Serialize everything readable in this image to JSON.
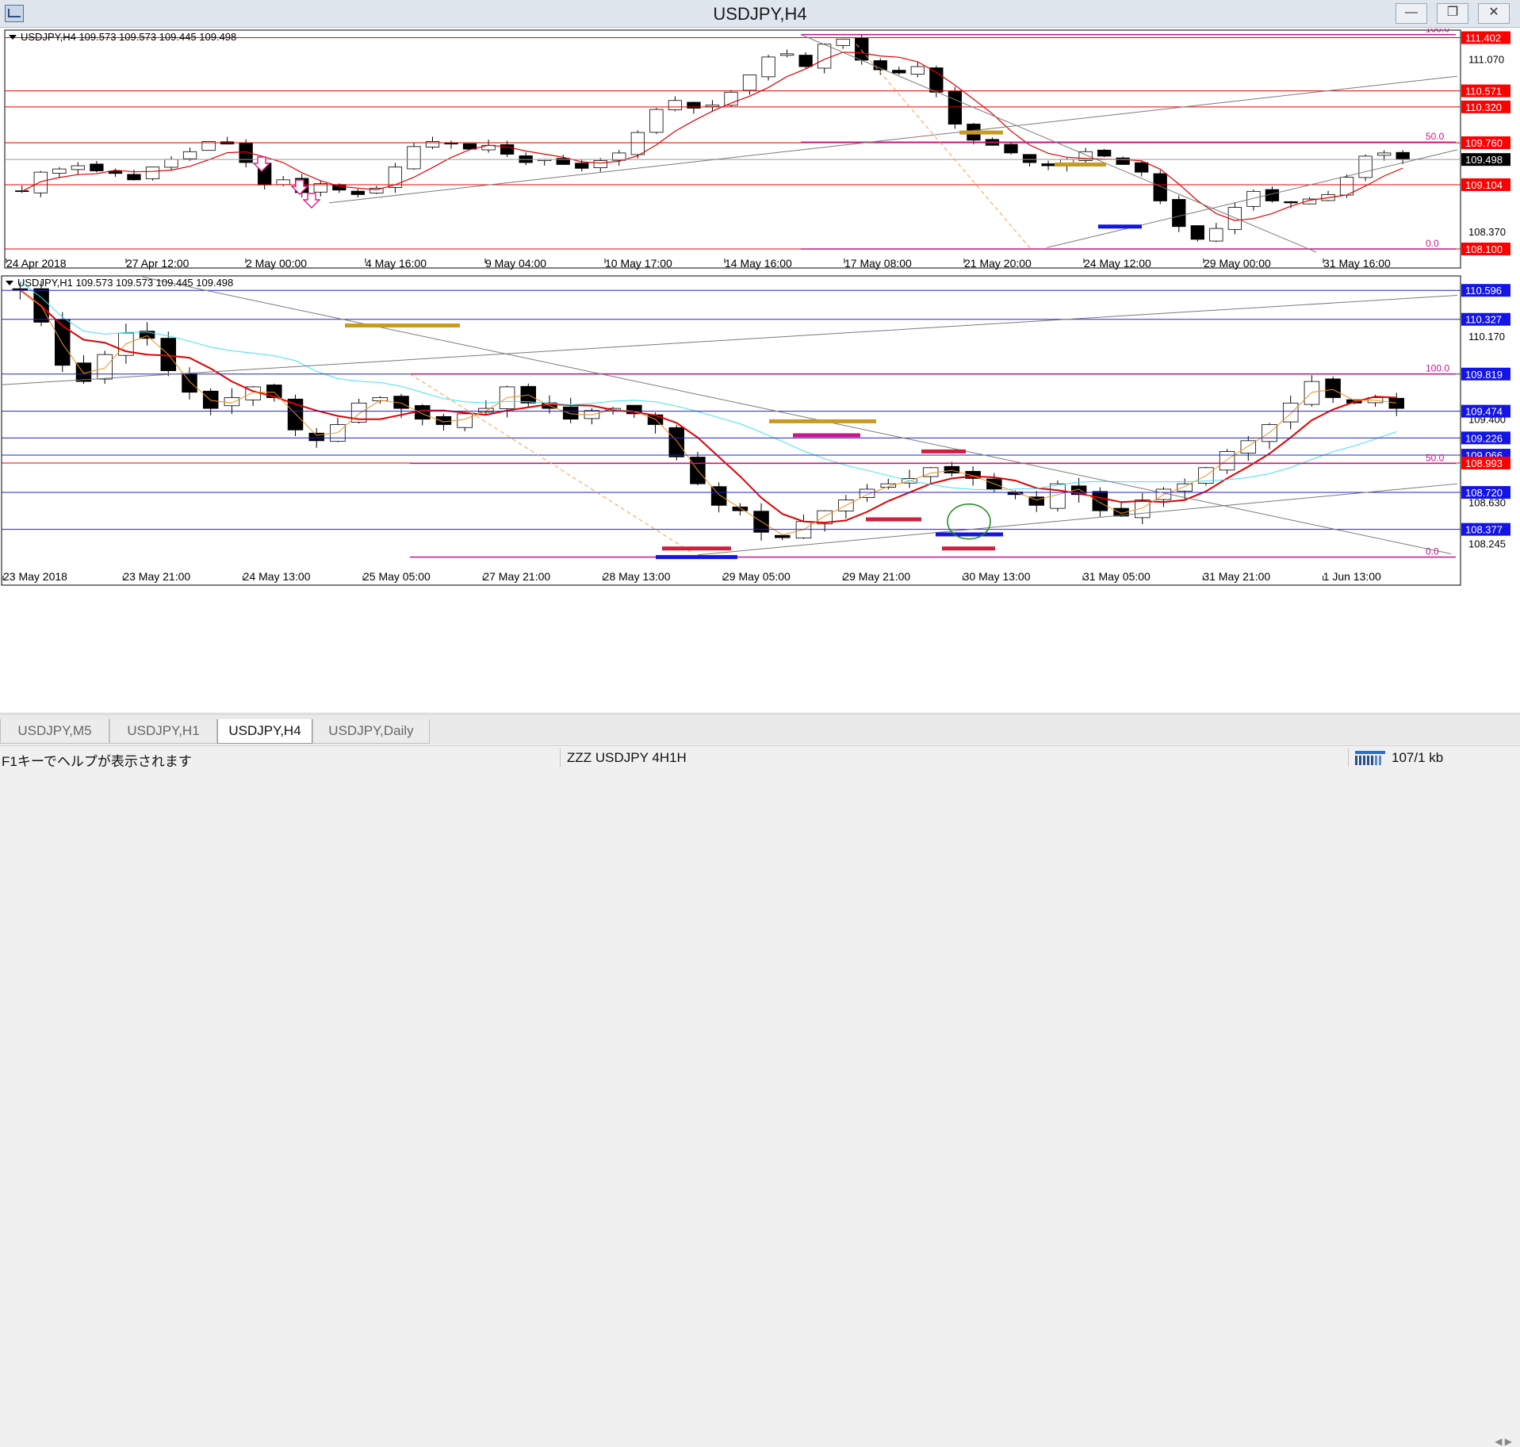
{
  "window": {
    "title": "USDJPY,H4",
    "buttons": [
      "minimize",
      "maximize",
      "close"
    ]
  },
  "colors": {
    "bull_fill": "#ffffff",
    "bear_fill": "#000000",
    "h_line": "#e60000",
    "h1_line": "#2020d0",
    "fib": "#c8148c",
    "label_red_bg": "#ff0000",
    "label_blue_bg": "#1414e6",
    "current_price_bg": "#000000",
    "trend": "#7a7a7a",
    "ma_red": "#e00000",
    "ma_orange": "#f09020",
    "ma_cyan": "#40e0f0",
    "gold": "#c89b1e"
  },
  "panels": {
    "h4": {
      "header": "USDJPY,H4  109.573 109.573 109.445 109.498",
      "price_range": [
        108.05,
        111.52
      ],
      "axis_ticks": [
        "111.070",
        "108.370"
      ],
      "levels": [
        {
          "price": "111.402",
          "style": "red"
        },
        {
          "price": "110.571",
          "style": "red"
        },
        {
          "price": "110.320",
          "style": "red"
        },
        {
          "price": "109.760",
          "style": "red"
        },
        {
          "price": "109.498",
          "style": "current"
        },
        {
          "price": "109.104",
          "style": "red"
        },
        {
          "price": "108.100",
          "style": "red"
        }
      ],
      "fib_labels": [
        "100.0",
        "50.0",
        "0.0"
      ],
      "time_labels": [
        "24 Apr 2018",
        "27 Apr 12:00",
        "2 May 00:00",
        "4 May 16:00",
        "9 May 04:00",
        "10 May 17:00",
        "14 May 16:00",
        "17 May 08:00",
        "21 May 20:00",
        "24 May 12:00",
        "29 May 00:00",
        "31 May 16:00"
      ],
      "close_path": [
        109.0,
        109.3,
        109.35,
        109.4,
        109.32,
        109.28,
        109.18,
        109.38,
        109.5,
        109.62,
        109.78,
        109.74,
        109.45,
        109.1,
        109.18,
        108.98,
        109.12,
        109.02,
        108.95,
        109.05,
        109.38,
        109.7,
        109.78,
        109.74,
        109.66,
        109.72,
        109.58,
        109.45,
        109.5,
        109.42,
        109.36,
        109.48,
        109.6,
        109.92,
        110.28,
        110.42,
        110.3,
        110.35,
        110.55,
        110.82,
        111.1,
        111.15,
        110.95,
        111.3,
        111.38,
        111.05,
        110.9,
        110.85,
        110.95,
        110.55,
        110.05,
        109.8,
        109.72,
        109.6,
        109.45,
        109.4,
        109.5,
        109.62,
        109.55,
        109.42,
        109.3,
        108.85,
        108.45,
        108.25,
        108.42,
        108.75,
        109.0,
        108.85,
        108.82,
        108.88,
        108.95,
        109.22,
        109.55,
        109.6,
        109.5
      ]
    },
    "h1": {
      "header": "USDJPY,H1  109.573 109.573 109.445 109.498",
      "price_range": [
        108.08,
        110.73
      ],
      "axis_ticks": [
        "110.170",
        "109.400",
        "108.630",
        "108.245"
      ],
      "levels": [
        {
          "price": "110.596",
          "style": "blue"
        },
        {
          "price": "110.327",
          "style": "blue"
        },
        {
          "price": "109.819",
          "style": "blue"
        },
        {
          "price": "109.474",
          "style": "blue"
        },
        {
          "price": "109.226",
          "style": "blue"
        },
        {
          "price": "109.066",
          "style": "blue"
        },
        {
          "price": "108.993",
          "style": "red"
        },
        {
          "price": "108.720",
          "style": "blue"
        },
        {
          "price": "108.377",
          "style": "blue"
        }
      ],
      "fib_labels": [
        "100.0",
        "50.0",
        "0.0"
      ],
      "time_labels": [
        "23 May 2018",
        "23 May 21:00",
        "24 May 13:00",
        "25 May 05:00",
        "27 May 21:00",
        "28 May 13:00",
        "29 May 05:00",
        "29 May 21:00",
        "30 May 13:00",
        "31 May 05:00",
        "31 May 21:00",
        "1 Jun 13:00"
      ],
      "close_path": [
        110.6,
        110.3,
        109.9,
        109.75,
        110.0,
        110.2,
        110.15,
        109.85,
        109.65,
        109.5,
        109.6,
        109.7,
        109.6,
        109.3,
        109.2,
        109.35,
        109.55,
        109.6,
        109.5,
        109.4,
        109.35,
        109.45,
        109.5,
        109.7,
        109.55,
        109.5,
        109.4,
        109.48,
        109.5,
        109.45,
        109.35,
        109.05,
        108.8,
        108.6,
        108.55,
        108.35,
        108.3,
        108.45,
        108.55,
        108.65,
        108.75,
        108.8,
        108.85,
        108.95,
        108.9,
        108.85,
        108.75,
        108.7,
        108.6,
        108.8,
        108.7,
        108.55,
        108.5,
        108.65,
        108.75,
        108.8,
        108.95,
        109.1,
        109.2,
        109.35,
        109.55,
        109.75,
        109.6,
        109.55,
        109.6,
        109.5
      ]
    }
  },
  "tabs": {
    "items": [
      "USDJPY,M5",
      "USDJPY,H1",
      "USDJPY,H4",
      "USDJPY,Daily"
    ],
    "active": "USDJPY,H4"
  },
  "status": {
    "help": "F1キーでヘルプが表示されます",
    "profile": "ZZZ USDJPY 4H1H",
    "traffic": "107/1 kb"
  }
}
